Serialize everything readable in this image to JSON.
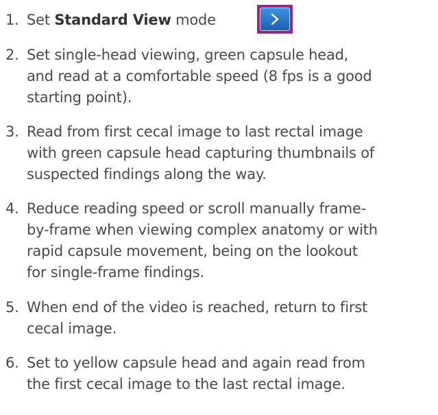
{
  "steps": [
    {
      "number": "1.",
      "pre": "Set ",
      "bold": "Standard View",
      "post": " mode",
      "button_icon": "chevron-right-icon"
    },
    {
      "number": "2.",
      "lines": [
        "Set single-head viewing, green capsule head,",
        "and read at a comfortable speed (8 fps is a good",
        "starting point)."
      ]
    },
    {
      "number": "3.",
      "lines": [
        "Read from first cecal image to last rectal image",
        "with green capsule head capturing thumbnails of",
        "suspected findings along the way."
      ]
    },
    {
      "number": "4.",
      "lines": [
        "Reduce reading speed or scroll manually frame-",
        "by-frame when viewing complex anatomy or with",
        "rapid capsule movement, being on the lookout",
        "for single-frame findings."
      ]
    },
    {
      "number": "5.",
      "lines": [
        "When end of the video is reached, return to first",
        "cecal image."
      ]
    },
    {
      "number": "6.",
      "lines": [
        "Set to yellow capsule head and again read from",
        "the first cecal image to the last rectal image."
      ]
    }
  ],
  "colors": {
    "text": "#4a4a4a",
    "button_border": "#8e2a8c",
    "button_fill": "#2a78cf"
  }
}
